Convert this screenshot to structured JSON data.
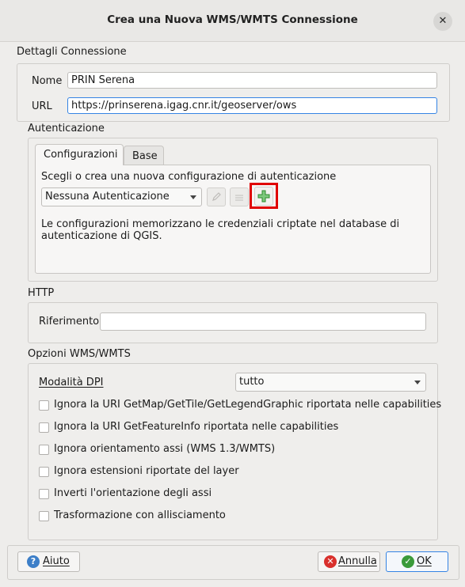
{
  "window": {
    "title": "Crea una Nuova WMS/WMTS Connessione",
    "close_symbol": "✕"
  },
  "connection": {
    "group_title": "Dettagli Connessione",
    "name_label": "Nome",
    "name_value": "PRIN Serena",
    "url_label": "URL",
    "url_value": "https://prinserena.igag.cnr.it/geoserver/ows"
  },
  "auth": {
    "group_title": "Autenticazione",
    "tabs": [
      {
        "label": "Configurazioni",
        "active": true
      },
      {
        "label": "Base",
        "active": false
      }
    ],
    "prompt": "Scegli o crea una nuova configurazione di autenticazione",
    "config_select_value": "Nessuna Autenticazione",
    "info_line1": "Le configurazioni memorizzano le credenziali criptate nel database di",
    "info_line2": "autenticazione di QGIS.",
    "highlight_color": "#e00000"
  },
  "http": {
    "group_title": "HTTP",
    "referer_label": "Riferimento",
    "referer_value": ""
  },
  "wms_options": {
    "group_title": "Opzioni WMS/WMTS",
    "dpi_label": "Modalità DPI",
    "dpi_value": "tutto",
    "checkboxes": [
      {
        "label": "Ignora la URI GetMap/GetTile/GetLegendGraphic riportata nelle capabilities",
        "checked": false
      },
      {
        "label": "Ignora la URI GetFeatureInfo riportata nelle capabilities",
        "checked": false
      },
      {
        "label": "Ignora orientamento assi (WMS 1.3/WMTS)",
        "checked": false
      },
      {
        "label": "Ignora estensioni riportate del layer",
        "checked": false
      },
      {
        "label": "Inverti l'orientazione degli assi",
        "checked": false
      },
      {
        "label": "Trasformazione con allisciamento",
        "checked": false
      }
    ]
  },
  "buttons": {
    "help": "Aiuto",
    "cancel": "Annulla",
    "ok": "OK"
  },
  "colors": {
    "accent": "#3584e4",
    "help_icon": "#3d7fc8",
    "cancel_icon": "#d9302c",
    "ok_icon": "#3a9a3a"
  }
}
